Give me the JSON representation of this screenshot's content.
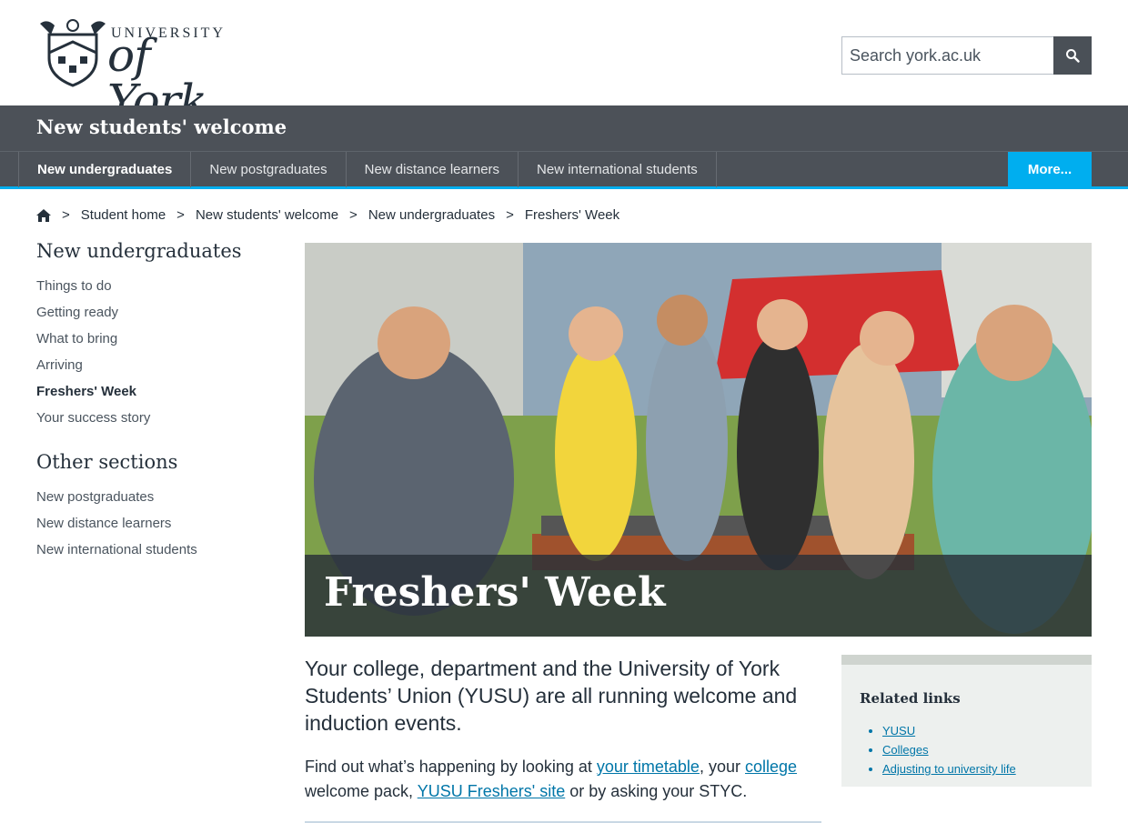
{
  "header": {
    "logo_text_top": "UNIVERSITY",
    "logo_text_main": "of York",
    "search_placeholder": "Search york.ac.uk",
    "search_icon": "search-icon"
  },
  "section": {
    "title": "New students' welcome"
  },
  "nav": {
    "items": [
      {
        "label": "New undergraduates",
        "active": true
      },
      {
        "label": "New postgraduates"
      },
      {
        "label": "New distance learners"
      },
      {
        "label": "New international students"
      }
    ],
    "more_label": "More...",
    "accent": "#00aeef"
  },
  "breadcrumb": {
    "home_icon": "home-icon",
    "separator": ">",
    "items": [
      "Student home",
      "New students' welcome",
      "New undergraduates",
      "Freshers' Week"
    ]
  },
  "sidebar": {
    "section1_title": "New undergraduates",
    "section1_items": [
      "Things to do",
      "Getting ready",
      "What to bring",
      "Arriving",
      "Freshers' Week",
      "Your success story"
    ],
    "section2_title": "Other sections",
    "section2_items": [
      "New postgraduates",
      "New distance learners",
      "New international students"
    ]
  },
  "hero": {
    "title": "Freshers' Week",
    "image_alt": "students at a barbecue on campus"
  },
  "main": {
    "lead": "Your college, department and the University of York Students’ Union (YUSU) are all running welcome and induction events.",
    "body_before": "Find out what’s happening by looking at ",
    "link1": "your timetable",
    "body_mid1": ", your ",
    "link2": "college",
    "body_mid2": " welcome pack, ",
    "link3": "YUSU Freshers' site",
    "body_after": " or by asking your STYC."
  },
  "related": {
    "title": "Related links",
    "links": [
      "YUSU",
      "Colleges",
      "Adjusting to university life"
    ]
  }
}
